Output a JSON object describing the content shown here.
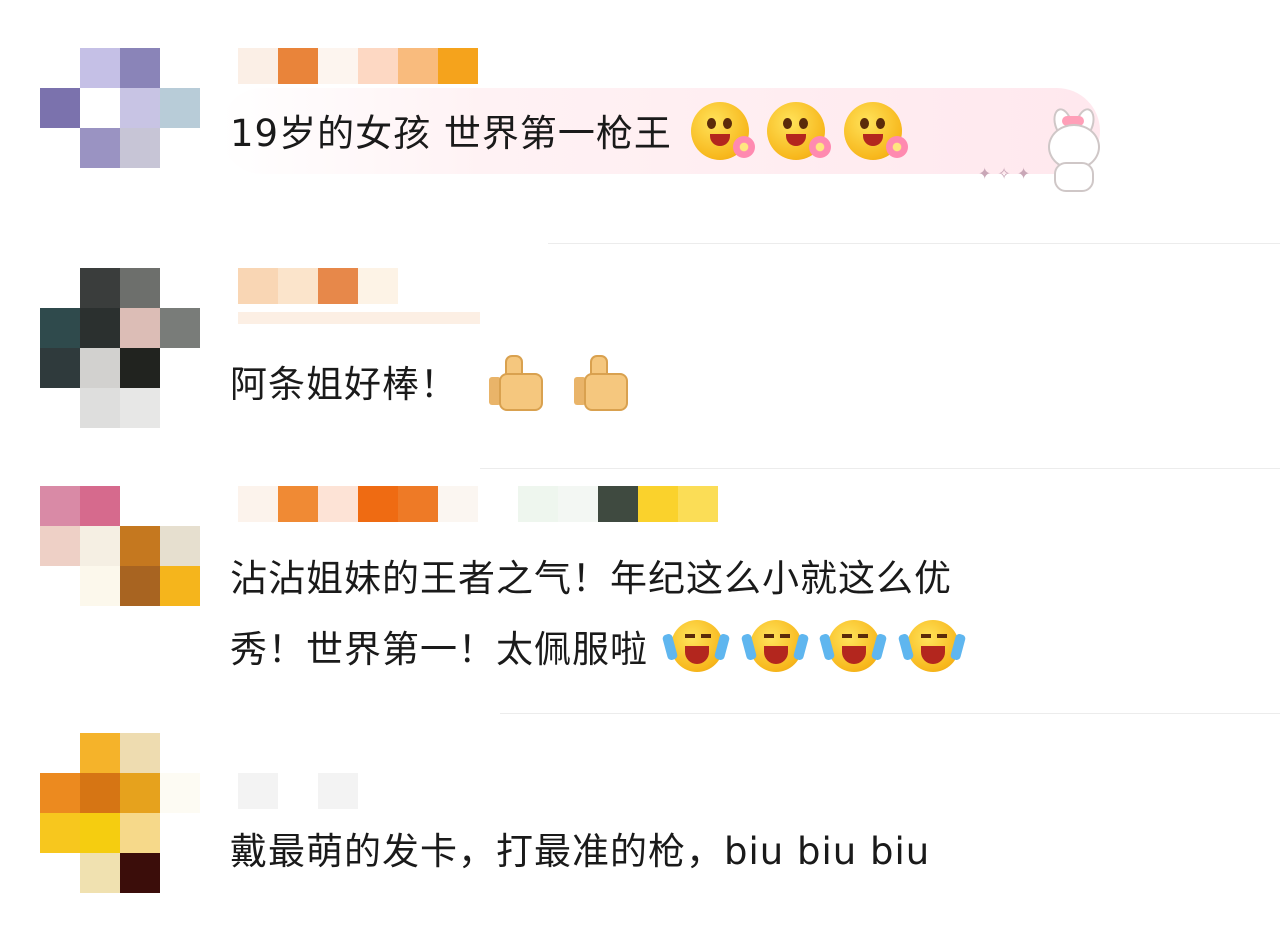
{
  "comments": [
    {
      "text": "19岁的女孩 世界第一枪王",
      "emoji": "smile-flower-emoji",
      "emoji_count": 3
    },
    {
      "text": "阿条姐好棒！",
      "emoji": "thumbs-up-emoji",
      "emoji_count": 2
    },
    {
      "text_line1": "沾沾姐妹的王者之气！年纪这么小就这么优",
      "text_line2": "秀！世界第一！太佩服啦",
      "emoji": "laugh-cry-emoji",
      "emoji_count": 4
    },
    {
      "text": "戴最萌的发卡，打最准的枪，biu biu biu"
    }
  ],
  "colors": {
    "bubble_pink": "#ffe8ee",
    "divider": "#ececec",
    "text": "#1a1a1a"
  }
}
